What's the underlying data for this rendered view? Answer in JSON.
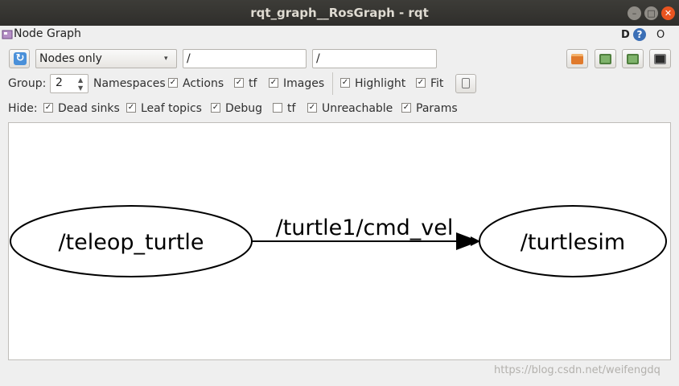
{
  "window": {
    "title": "rqt_graph__RosGraph - rqt",
    "controls": {
      "minimize": "–",
      "maximize": "□",
      "close": "✕"
    }
  },
  "dock": {
    "title": "Node Graph",
    "icon": "plugin-icon",
    "help_d": "D",
    "help_q": "?",
    "help_o": "O"
  },
  "toolbar": {
    "refresh_icon": "refresh-icon",
    "refresh_glyph": "↻",
    "mode_select": {
      "selected": "Nodes only",
      "options": [
        "Nodes only"
      ]
    },
    "mode_arrow": "▾",
    "ns_filter": "/",
    "topic_filter": "/",
    "right_buttons": [
      "load-dot-icon",
      "save-dot-icon",
      "save-image-icon",
      "screenshot-icon"
    ]
  },
  "options_row": {
    "group_label": "Group:",
    "group_value": "2",
    "spin_up": "▲",
    "spin_down": "▼",
    "namespaces_label": "Namespaces",
    "checkboxes": [
      {
        "label": "Actions",
        "checked": true
      },
      {
        "label": "tf",
        "checked": true
      },
      {
        "label": "Images",
        "checked": true
      },
      {
        "label": "Highlight",
        "checked": true
      },
      {
        "label": "Fit",
        "checked": true
      }
    ]
  },
  "hide_row": {
    "label": "Hide:",
    "checkboxes": [
      {
        "label": "Dead sinks",
        "checked": true
      },
      {
        "label": "Leaf topics",
        "checked": true
      },
      {
        "label": "Debug",
        "checked": true
      },
      {
        "label": "tf",
        "checked": false
      },
      {
        "label": "Unreachable",
        "checked": true
      },
      {
        "label": "Params",
        "checked": true
      }
    ]
  },
  "graph": {
    "nodes": [
      {
        "label": "/teleop_turtle"
      },
      {
        "label": "/turtlesim"
      }
    ],
    "edges": [
      {
        "from": "/teleop_turtle",
        "to": "/turtlesim",
        "label": "/turtle1/cmd_vel"
      }
    ]
  },
  "watermark": "https://blog.csdn.net/weifengdq",
  "colors": {
    "titlebar": "#3d3c38",
    "close": "#e95420",
    "canvas": "#ffffff",
    "window": "#efefef"
  }
}
